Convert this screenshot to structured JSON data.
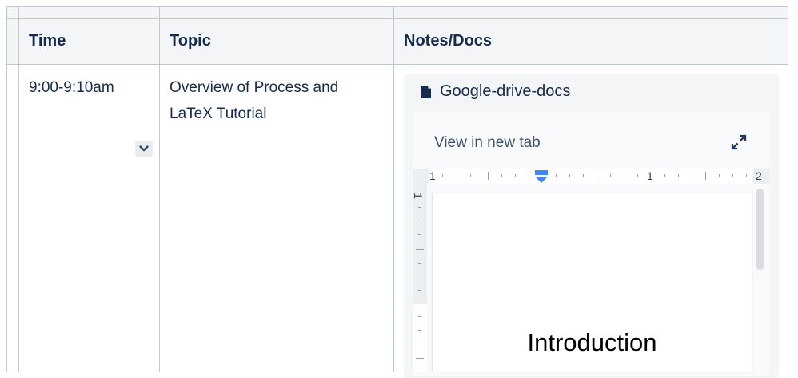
{
  "table": {
    "headers": {
      "time": "Time",
      "topic": "Topic",
      "notes": "Notes/Docs"
    },
    "rows": [
      {
        "time": "9:00-9:10am",
        "topic": "Overview of Process and LaTeX Tutorial"
      }
    ]
  },
  "embed": {
    "file_icon": "document-icon",
    "title": "Google-drive-docs",
    "view_link": "View in new tab",
    "expand_icon": "expand-icon",
    "ruler_labels": [
      "1",
      "1",
      "2"
    ],
    "vertical_ruler_label": "1",
    "doc_heading": "Introduction"
  },
  "colors": {
    "text": "#172b4d",
    "header_bg": "#f4f5f7",
    "border": "#c1c7d0",
    "ruler_marker": "#4285f4"
  }
}
